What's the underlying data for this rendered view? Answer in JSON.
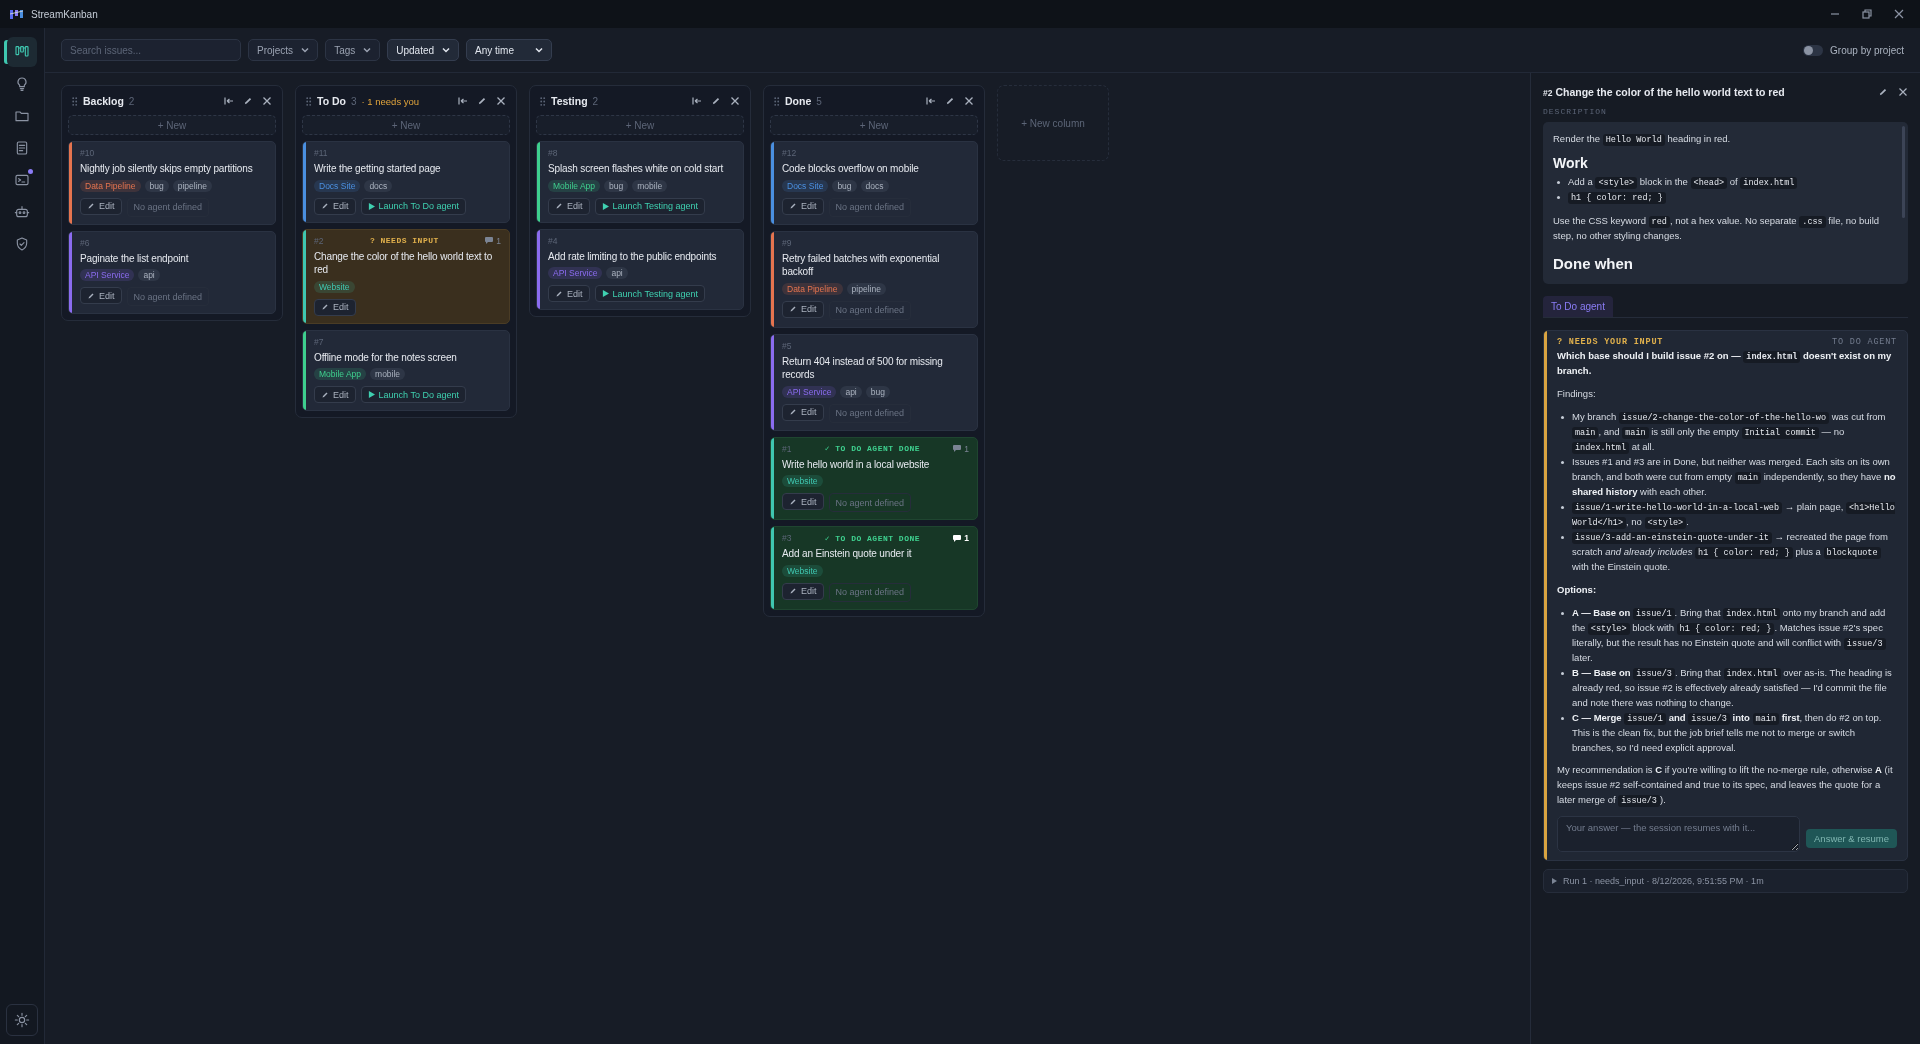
{
  "app": {
    "title": "StreamKanban"
  },
  "rail": {
    "items": [
      {
        "kind": "board",
        "selected": true,
        "badge": false
      },
      {
        "kind": "bulb",
        "selected": false,
        "badge": false
      },
      {
        "kind": "folder",
        "selected": false,
        "badge": false
      },
      {
        "kind": "document",
        "selected": false,
        "badge": false
      },
      {
        "kind": "terminal",
        "selected": false,
        "badge": true
      },
      {
        "kind": "robot",
        "selected": false,
        "badge": false
      },
      {
        "kind": "shield",
        "selected": false,
        "badge": false
      }
    ],
    "footer": {
      "kind": "sun"
    }
  },
  "toolbar": {
    "search": {
      "placeholder": "Search issues..."
    },
    "filters": [
      {
        "label": "Projects",
        "active": false
      },
      {
        "label": "Tags",
        "active": false
      },
      {
        "label": "Updated",
        "active": true
      },
      {
        "label": "Any time",
        "active": true
      }
    ],
    "group_toggle": {
      "label": "Group by project",
      "on": false
    }
  },
  "columns": [
    {
      "name": "Backlog",
      "count": "2",
      "new_label": "+ New",
      "cards": [
        {
          "id": "#10",
          "title": "Nightly job silently skips empty partitions",
          "kind": "plain",
          "color": "#e5744f",
          "tags": [
            {
              "label": "Data Pipeline",
              "kind": "project"
            },
            {
              "label": "bug",
              "kind": "label"
            },
            {
              "label": "pipeline",
              "kind": "label"
            }
          ],
          "edit": "Edit",
          "agent": {
            "label": "No agent defined",
            "available": false
          }
        },
        {
          "id": "#6",
          "title": "Paginate the list endpoint",
          "kind": "plain",
          "color": "#8b6cf0",
          "tags": [
            {
              "label": "API Service",
              "kind": "project"
            },
            {
              "label": "api",
              "kind": "label"
            }
          ],
          "edit": "Edit",
          "agent": {
            "label": "No agent defined",
            "available": false
          }
        }
      ]
    },
    {
      "name": "To Do",
      "count": "3",
      "alert": "· 1 needs you",
      "new_label": "+ New",
      "cards": [
        {
          "id": "#11",
          "title": "Write the getting started page",
          "kind": "plain",
          "color": "#4a8fe0",
          "tags": [
            {
              "label": "Docs Site",
              "kind": "project"
            },
            {
              "label": "docs",
              "kind": "label"
            }
          ],
          "edit": "Edit",
          "agent": {
            "label": "Launch To Do agent",
            "available": true
          }
        },
        {
          "id": "#2",
          "title": "Change the color of the hello world text to red",
          "kind": "needs_input",
          "status": "? NEEDS INPUT",
          "comments": "1",
          "comments_unread": false,
          "color": "#3fc7b0",
          "tags": [
            {
              "label": "Website",
              "kind": "project"
            }
          ],
          "edit": "Edit"
        },
        {
          "id": "#7",
          "title": "Offline mode for the notes screen",
          "kind": "plain",
          "color": "#3ecf8e",
          "tags": [
            {
              "label": "Mobile App",
              "kind": "project"
            },
            {
              "label": "mobile",
              "kind": "label"
            }
          ],
          "edit": "Edit",
          "agent": {
            "label": "Launch To Do agent",
            "available": true
          }
        }
      ]
    },
    {
      "name": "Testing",
      "count": "2",
      "new_label": "+ New",
      "cards": [
        {
          "id": "#8",
          "title": "Splash screen flashes white on cold start",
          "kind": "plain",
          "color": "#3ecf8e",
          "tags": [
            {
              "label": "Mobile App",
              "kind": "project"
            },
            {
              "label": "bug",
              "kind": "label"
            },
            {
              "label": "mobile",
              "kind": "label"
            }
          ],
          "edit": "Edit",
          "agent": {
            "label": "Launch Testing agent",
            "available": true
          }
        },
        {
          "id": "#4",
          "title": "Add rate limiting to the public endpoints",
          "kind": "plain",
          "color": "#8b6cf0",
          "tags": [
            {
              "label": "API Service",
              "kind": "project"
            },
            {
              "label": "api",
              "kind": "label"
            }
          ],
          "edit": "Edit",
          "agent": {
            "label": "Launch Testing agent",
            "available": true
          }
        }
      ]
    },
    {
      "name": "Done",
      "count": "5",
      "new_label": "+ New",
      "cards": [
        {
          "id": "#12",
          "title": "Code blocks overflow on mobile",
          "kind": "plain",
          "color": "#4a8fe0",
          "tags": [
            {
              "label": "Docs Site",
              "kind": "project"
            },
            {
              "label": "bug",
              "kind": "label"
            },
            {
              "label": "docs",
              "kind": "label"
            }
          ],
          "edit": "Edit",
          "agent": {
            "label": "No agent defined",
            "available": false
          }
        },
        {
          "id": "#9",
          "title": "Retry failed batches with exponential backoff",
          "kind": "plain",
          "color": "#e5744f",
          "tags": [
            {
              "label": "Data Pipeline",
              "kind": "project"
            },
            {
              "label": "pipeline",
              "kind": "label"
            }
          ],
          "edit": "Edit",
          "agent": {
            "label": "No agent defined",
            "available": false
          }
        },
        {
          "id": "#5",
          "title": "Return 404 instead of 500 for missing records",
          "kind": "plain",
          "color": "#8b6cf0",
          "tags": [
            {
              "label": "API Service",
              "kind": "project"
            },
            {
              "label": "api",
              "kind": "label"
            },
            {
              "label": "bug",
              "kind": "label"
            }
          ],
          "edit": "Edit",
          "agent": {
            "label": "No agent defined",
            "available": false
          }
        },
        {
          "id": "#1",
          "title": "Write hello world in a local website",
          "kind": "agent_done",
          "status": "✓ TO DO AGENT DONE",
          "comments": "1",
          "comments_unread": false,
          "color": "#3fc7b0",
          "tags": [
            {
              "label": "Website",
              "kind": "project"
            }
          ],
          "edit": "Edit",
          "agent": {
            "label": "No agent defined",
            "available": false
          }
        },
        {
          "id": "#3",
          "title": "Add an Einstein quote under it",
          "kind": "agent_done",
          "status": "✓ TO DO AGENT DONE",
          "comments": "1",
          "comments_unread": true,
          "color": "#3fc7b0",
          "tags": [
            {
              "label": "Website",
              "kind": "project"
            }
          ],
          "edit": "Edit",
          "agent": {
            "label": "No agent defined",
            "available": false
          }
        }
      ]
    }
  ],
  "new_column": {
    "label": "+ New column"
  },
  "detail": {
    "id": "#2",
    "title": "Change the color of the hello world text to red",
    "description_label": "DESCRIPTION",
    "description": [
      {
        "kind": "p",
        "segments": [
          "Render the ",
          {
            "code": "Hello World"
          },
          " heading in red."
        ]
      },
      {
        "kind": "h",
        "text": "Work"
      },
      {
        "kind": "ul",
        "items": [
          [
            "Add a ",
            {
              "code": "<style>"
            },
            " block in the ",
            {
              "code": "<head>"
            },
            " of ",
            {
              "code": "index.html"
            }
          ],
          [
            {
              "code": "h1 { color: red; }"
            }
          ]
        ]
      },
      {
        "kind": "p",
        "segments": [
          "Use the CSS keyword ",
          {
            "code": "red"
          },
          ", not a hex value. No separate ",
          {
            "code": ".css"
          },
          " file, no build step, no other styling changes."
        ]
      },
      {
        "kind": "h",
        "text": "Done when"
      }
    ],
    "tabs": [
      {
        "label": "To Do agent",
        "selected": true
      }
    ],
    "message": {
      "status": "? NEEDS YOUR INPUT",
      "agent": "TO DO AGENT",
      "blocks": [
        {
          "kind": "strong",
          "segments": [
            "Which base should I build issue #2 on — ",
            {
              "code": "index.html"
            },
            " doesn't exist on my branch."
          ]
        },
        {
          "kind": "p",
          "segments": [
            "Findings:"
          ]
        },
        {
          "kind": "ul",
          "items": [
            [
              "My branch ",
              {
                "code": "issue/2-change-the-color-of-the-hello-wo"
              },
              " was cut from ",
              {
                "code": "main"
              },
              ", and ",
              {
                "code": "main"
              },
              " is still only the empty ",
              {
                "code": "Initial commit"
              },
              " — no ",
              {
                "code": "index.html"
              },
              " at all."
            ],
            [
              "Issues #1 and #3 are in Done, but neither was merged. Each sits on its own branch, and both were cut from empty ",
              {
                "code": "main"
              },
              " independently, so they have **no shared history** with each other."
            ],
            [
              {
                "code": "issue/1-write-hello-world-in-a-local-web"
              },
              " → plain page, ",
              {
                "code": "<h1>Hello World</h1>"
              },
              ", no ",
              {
                "code": "<style>"
              },
              "."
            ],
            [
              {
                "code": "issue/3-add-an-einstein-quote-under-it"
              },
              " → recreated the page from scratch *and already includes* ",
              {
                "code": "h1 { color: red; }"
              },
              " plus a ",
              {
                "code": "blockquote"
              },
              " with the Einstein quote."
            ]
          ]
        },
        {
          "kind": "strong",
          "segments": [
            "Options:"
          ]
        },
        {
          "kind": "ul",
          "items": [
            [
              "**A — Base on** ",
              {
                "code": "issue/1"
              },
              ". Bring that ",
              {
                "code": "index.html"
              },
              " onto my branch and add the ",
              {
                "code": "<style>"
              },
              " block with ",
              {
                "code": "h1 { color: red; }"
              },
              ". Matches issue #2's spec literally, but the result has no Einstein quote and will conflict with ",
              {
                "code": "issue/3"
              },
              " later."
            ],
            [
              "**B — Base on** ",
              {
                "code": "issue/3"
              },
              ". Bring that ",
              {
                "code": "index.html"
              },
              " over as-is. The heading is already red, so issue #2 is effectively already satisfied — I'd commit the file and note there was nothing to change."
            ],
            [
              "**C — Merge** ",
              {
                "code": "issue/1"
              },
              " **and** ",
              {
                "code": "issue/3"
              },
              " **into** ",
              {
                "code": "main"
              },
              " **first**, then do #2 on top. This is the clean fix, but the job brief tells me not to merge or switch branches, so I'd need explicit approval."
            ]
          ]
        },
        {
          "kind": "p",
          "segments": [
            "My recommendation is **C** if you're willing to lift the no-merge rule, otherwise **A** (it keeps issue #2 self-contained and true to its spec, and leaves the quote for a later merge of ",
            {
              "code": "issue/3"
            },
            ")."
          ]
        }
      ],
      "answer": {
        "placeholder": "Your answer — the session resumes with it...",
        "button": "Answer & resume"
      }
    },
    "run": {
      "label": "Run 1 · needs_input · 8/12/2026, 9:51:55 PM · 1m",
      "expanded": false
    }
  }
}
